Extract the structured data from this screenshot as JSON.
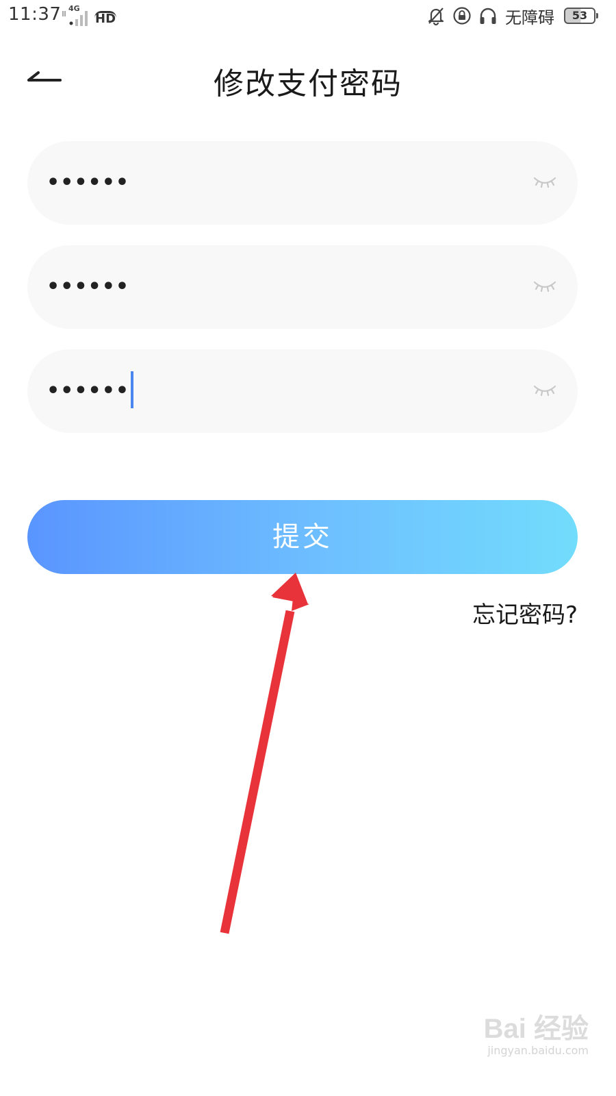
{
  "status_bar": {
    "time": "11:37",
    "network": "4G",
    "hd_label": "HD",
    "accessibility": "无障碍",
    "battery": "53",
    "icons": [
      "bell-off-icon",
      "lock-rotation-icon",
      "headphones-icon"
    ]
  },
  "header": {
    "title": "修改支付密码",
    "back_icon": "back-arrow-icon"
  },
  "fields": [
    {
      "value": "••••••",
      "focused": false,
      "icon": "eye-closed-icon"
    },
    {
      "value": "••••••",
      "focused": false,
      "icon": "eye-closed-icon"
    },
    {
      "value": "••••••",
      "focused": true,
      "icon": "eye-closed-icon"
    }
  ],
  "submit_label": "提交",
  "forgot_label": "忘记密码?",
  "watermark": {
    "brand": "Bai 经验",
    "url": "jingyan.baidu.com"
  },
  "colors": {
    "button_gradient_start": "#5a95ff",
    "button_gradient_end": "#72dcfc",
    "field_bg": "#f8f8f8",
    "caret": "#4a86f0",
    "annotation": "#e8333a"
  }
}
